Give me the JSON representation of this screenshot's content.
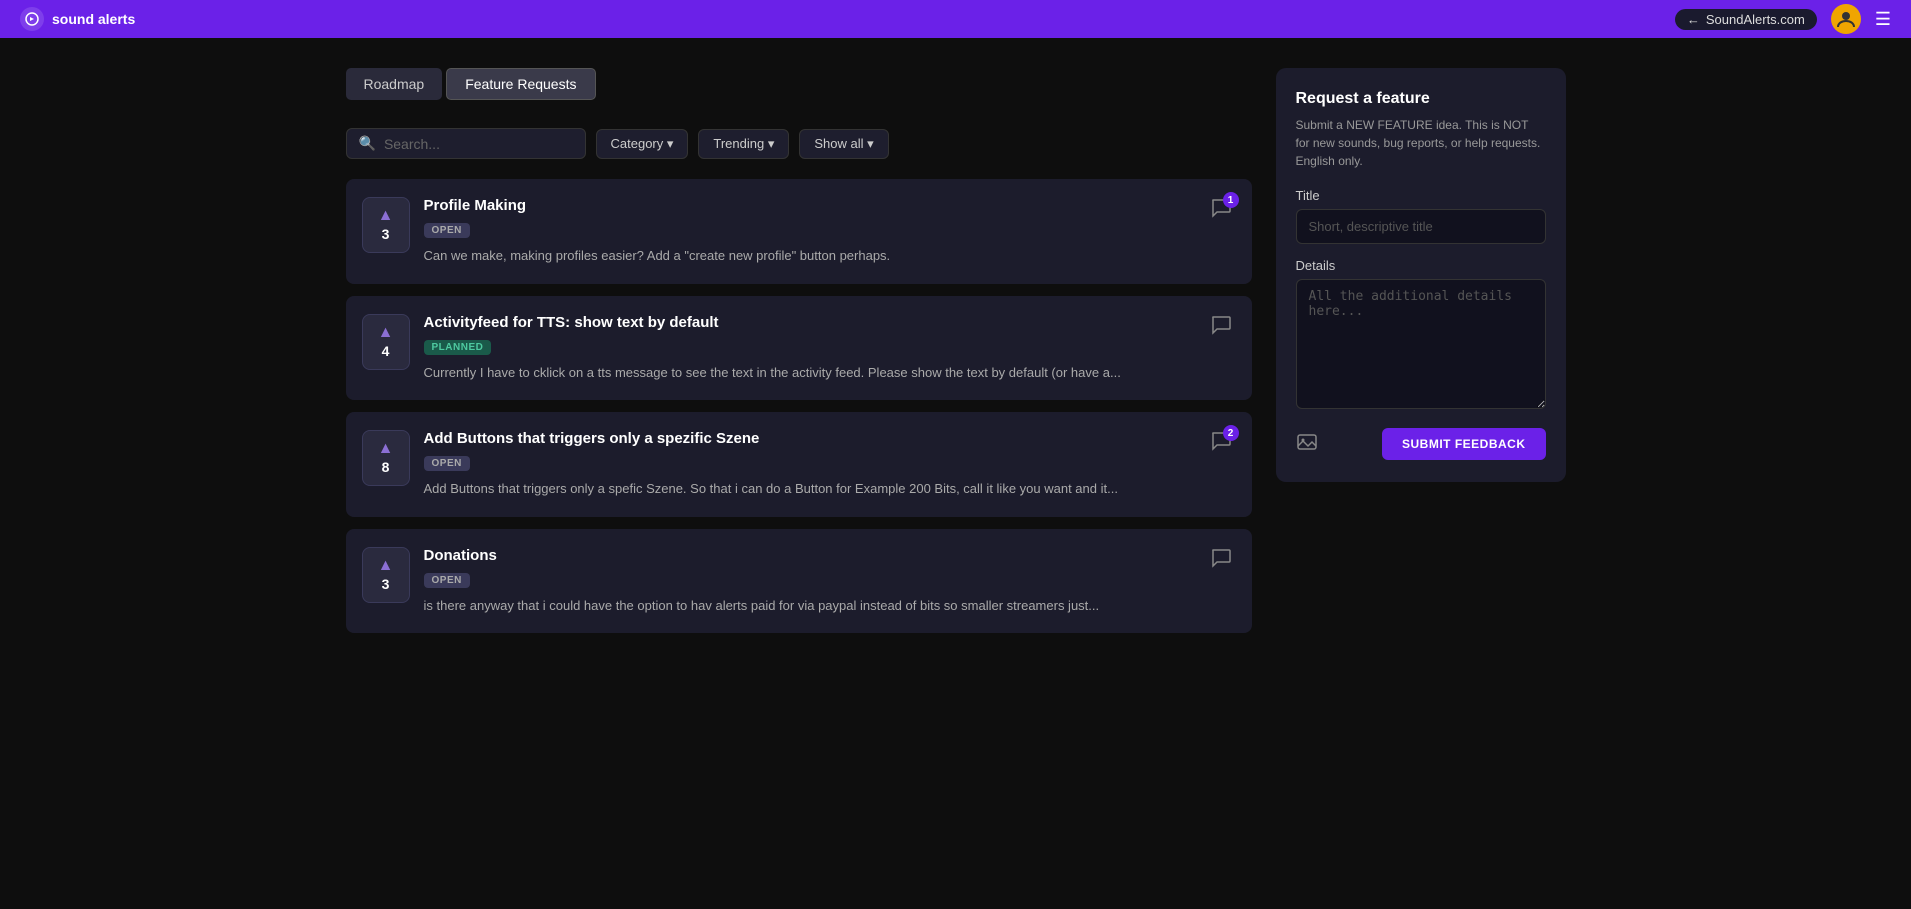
{
  "header": {
    "logo_text": "sound alerts",
    "site_link": "SoundAlerts.com",
    "back_arrow": "←"
  },
  "tabs": [
    {
      "id": "roadmap",
      "label": "Roadmap",
      "active": false
    },
    {
      "id": "feature-requests",
      "label": "Feature Requests",
      "active": true
    }
  ],
  "filters": {
    "search_placeholder": "Search...",
    "category_label": "Category ▾",
    "trending_label": "Trending ▾",
    "show_all_label": "Show all ▾"
  },
  "cards": [
    {
      "id": "card-1",
      "title": "Profile Making",
      "badge": "OPEN",
      "badge_type": "open",
      "votes": 3,
      "description": "Can we make, making profiles easier? Add a \"create new profile\" button perhaps.",
      "comments": 1
    },
    {
      "id": "card-2",
      "title": "Activityfeed for TTS: show text by default",
      "badge": "PLANNED",
      "badge_type": "planned",
      "votes": 4,
      "description": "Currently I have to cklick on a tts message to see the text in the activity feed. Please show the text by default (or have a...",
      "comments": 0
    },
    {
      "id": "card-3",
      "title": "Add Buttons that triggers only a spezific Szene",
      "badge": "OPEN",
      "badge_type": "open",
      "votes": 8,
      "description": "Add Buttons that triggers only a spefic Szene. So that i can do a Button for Example 200 Bits, call it like you want and it...",
      "comments": 2
    },
    {
      "id": "card-4",
      "title": "Donations",
      "badge": "OPEN",
      "badge_type": "open",
      "votes": 3,
      "description": "is there anyway that i could have the option to hav alerts paid for via paypal instead of bits so smaller streamers just...",
      "comments": 0
    }
  ],
  "request_form": {
    "title": "Request a feature",
    "description": "Submit a NEW FEATURE idea. This is NOT for new sounds, bug reports, or help requests. English only.",
    "title_label": "Title",
    "title_placeholder": "Short, descriptive title",
    "details_label": "Details",
    "details_placeholder": "All the additional details here...",
    "submit_label": "SUBMIT FEEDBACK"
  }
}
